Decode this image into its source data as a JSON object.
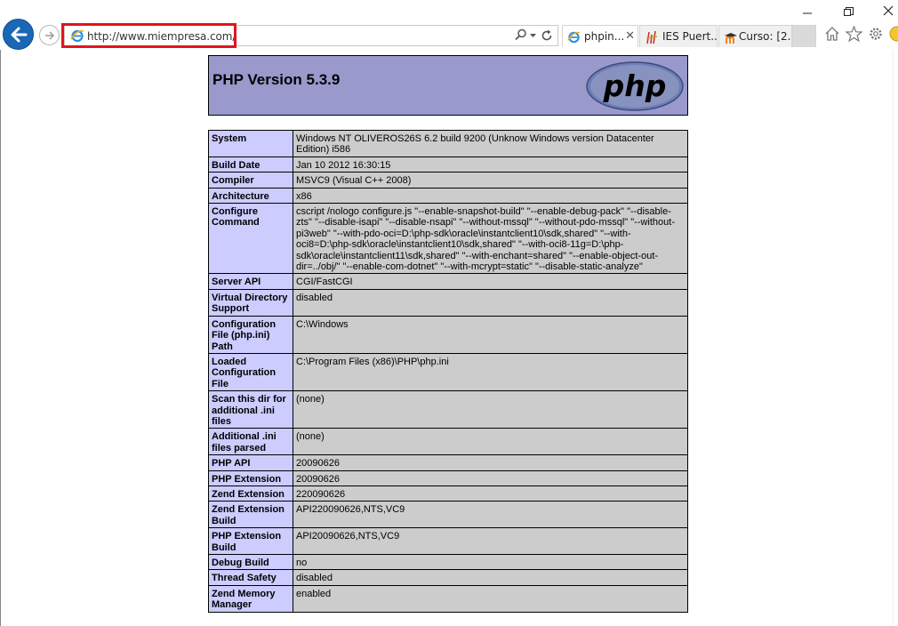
{
  "browser": {
    "url": "http://www.miempresa.com/",
    "tabs": [
      {
        "label": "phpin...",
        "active": true
      },
      {
        "label": "IES Puert...",
        "active": false
      },
      {
        "label": "Curso: [2...",
        "active": false
      }
    ],
    "close_tab_glyph": "✕",
    "icons": [
      "back-arrow-icon",
      "forward-arrow-icon",
      "ie-logo-icon",
      "search-icon",
      "refresh-icon",
      "home-icon",
      "favorites-star-icon",
      "settings-gear-icon",
      "smiley-icon"
    ],
    "colors": {
      "highlight": "#e0141e",
      "back_button": "#1a67b6"
    }
  },
  "php": {
    "version_title": "PHP Version 5.3.9",
    "logo_text": "php",
    "colors": {
      "header": "#9999cc",
      "key_cell": "#ccccff",
      "value_cell": "#cccccc"
    },
    "rows": [
      {
        "key": "System",
        "value": "Windows NT OLIVEROS26S 6.2 build 9200 (Unknow Windows version Datacenter Edition) i586"
      },
      {
        "key": "Build Date",
        "value": "Jan 10 2012 16:30:15"
      },
      {
        "key": "Compiler",
        "value": "MSVC9 (Visual C++ 2008)"
      },
      {
        "key": "Architecture",
        "value": "x86"
      },
      {
        "key": "Configure Command",
        "value": "cscript /nologo configure.js \"--enable-snapshot-build\" \"--enable-debug-pack\" \"--disable-zts\" \"--disable-isapi\" \"--disable-nsapi\" \"--without-mssql\" \"--without-pdo-mssql\" \"--without-pi3web\" \"--with-pdo-oci=D:\\php-sdk\\oracle\\instantclient10\\sdk,shared\" \"--with-oci8=D:\\php-sdk\\oracle\\instantclient10\\sdk,shared\" \"--with-oci8-11g=D:\\php-sdk\\oracle\\instantclient11\\sdk,shared\" \"--with-enchant=shared\" \"--enable-object-out-dir=../obj/\" \"--enable-com-dotnet\" \"--with-mcrypt=static\" \"--disable-static-analyze\""
      },
      {
        "key": "Server API",
        "value": "CGI/FastCGI"
      },
      {
        "key": "Virtual Directory Support",
        "value": "disabled"
      },
      {
        "key": "Configuration File (php.ini) Path",
        "value": "C:\\Windows"
      },
      {
        "key": "Loaded Configuration File",
        "value": "C:\\Program Files (x86)\\PHP\\php.ini"
      },
      {
        "key": "Scan this dir for additional .ini files",
        "value": "(none)"
      },
      {
        "key": "Additional .ini files parsed",
        "value": "(none)"
      },
      {
        "key": "PHP API",
        "value": "20090626"
      },
      {
        "key": "PHP Extension",
        "value": "20090626"
      },
      {
        "key": "Zend Extension",
        "value": "220090626"
      },
      {
        "key": "Zend Extension Build",
        "value": "API220090626,NTS,VC9"
      },
      {
        "key": "PHP Extension Build",
        "value": "API20090626,NTS,VC9"
      },
      {
        "key": "Debug Build",
        "value": "no"
      },
      {
        "key": "Thread Safety",
        "value": "disabled"
      },
      {
        "key": "Zend Memory Manager",
        "value": "enabled"
      }
    ]
  }
}
